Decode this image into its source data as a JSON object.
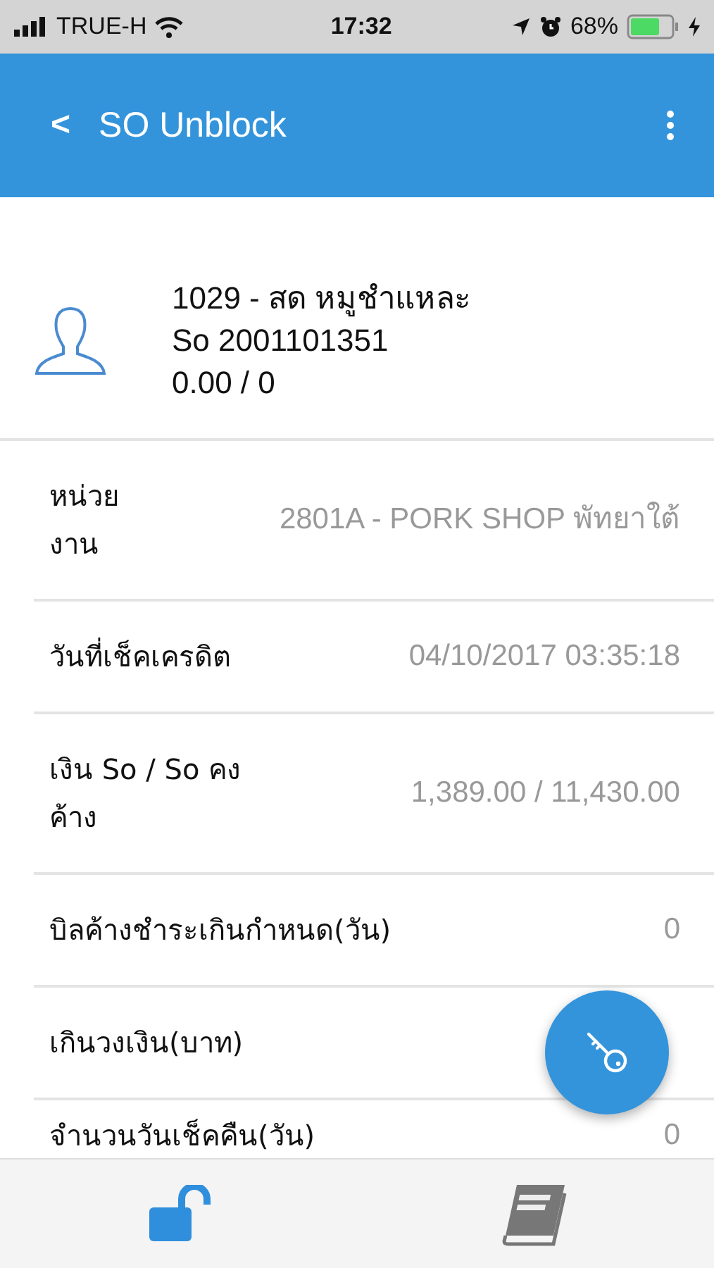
{
  "status_bar": {
    "carrier": "TRUE-H",
    "time": "17:32",
    "battery": "68%"
  },
  "header": {
    "back": "<",
    "title": "SO Unblock"
  },
  "customer": {
    "lines": [
      "1029 - สด หมูชำแหละ",
      "So 2001101351",
      "0.00 / 0"
    ]
  },
  "rows": [
    {
      "label": "หน่วย\nงาน",
      "value": "2801A - PORK SHOP พัทยาใต้"
    },
    {
      "label": "วันที่เช็คเครดิต",
      "value": "04/10/2017 03:35:18"
    },
    {
      "label": "เงิน So / So คง\nค้าง",
      "value": "1,389.00 / 11,430.00"
    },
    {
      "label": "บิลค้างชำระเกินกำหนด(วัน)",
      "value": "0"
    },
    {
      "label": "เกินวงเงิน(บาท)"
    },
    {
      "label": "จำนวนวันเช็คคืน(วัน)",
      "value": "0"
    }
  ],
  "tabs": [
    {
      "kind": "unlock",
      "selected": true
    },
    {
      "kind": "book",
      "selected": false
    }
  ]
}
